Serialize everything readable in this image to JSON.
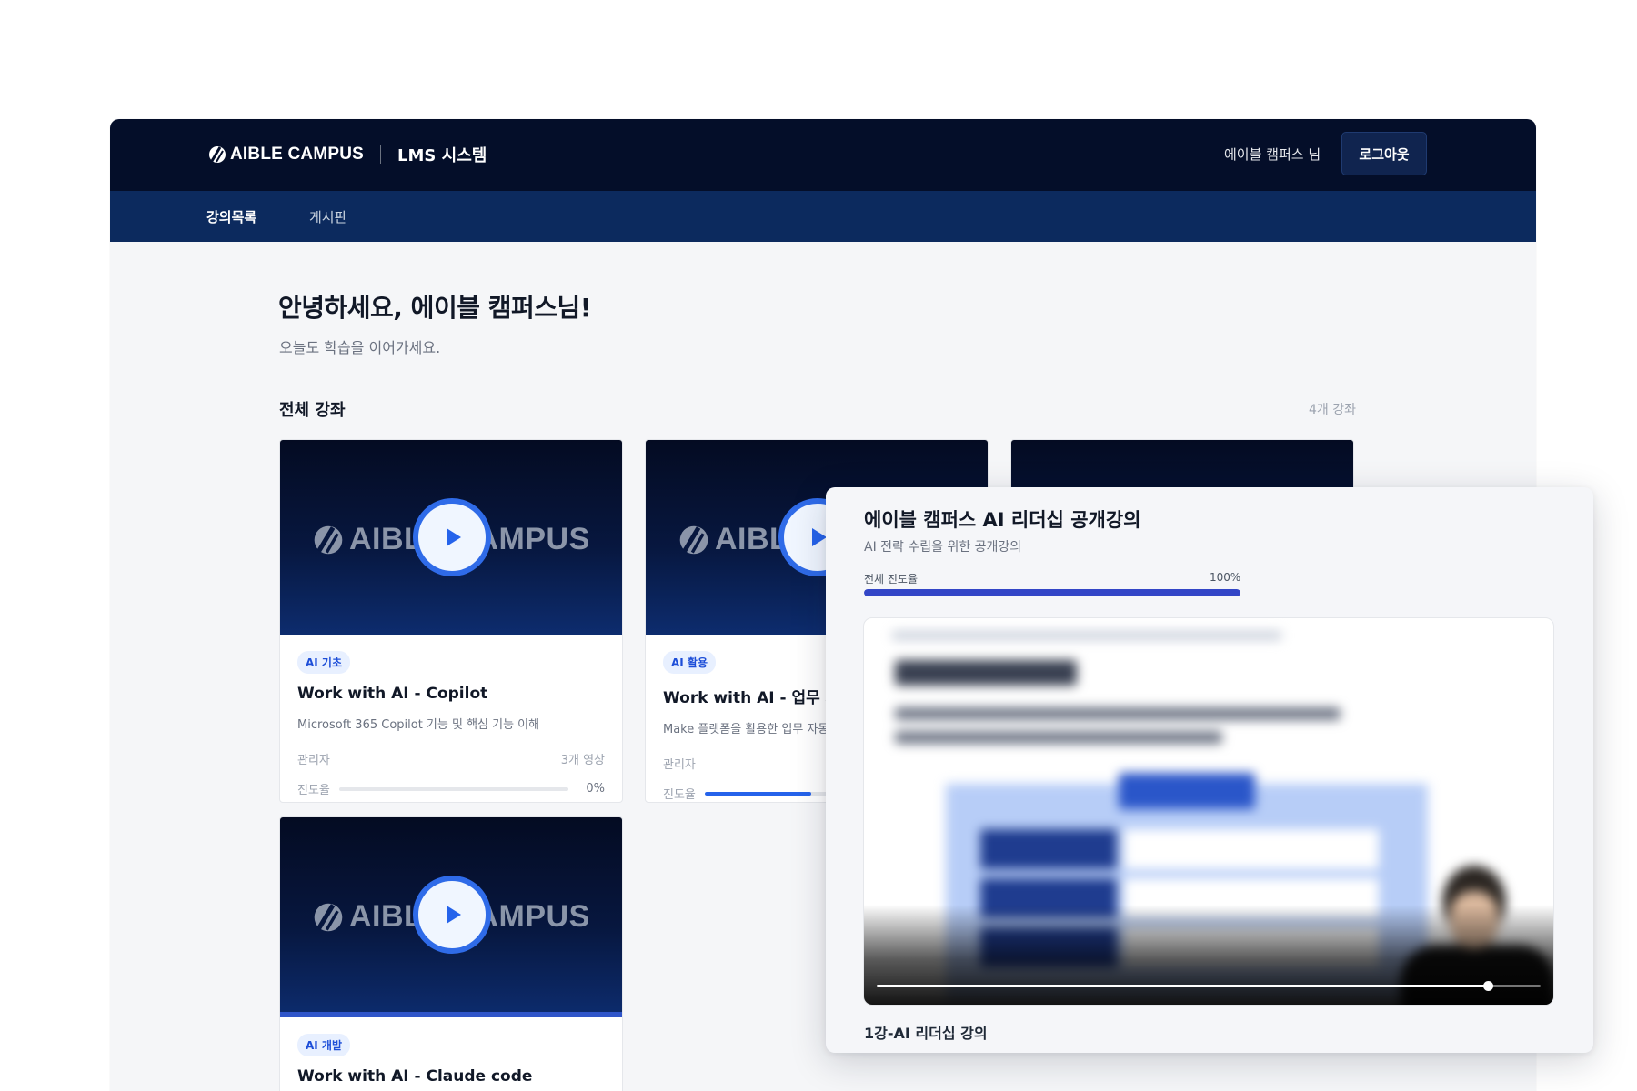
{
  "header": {
    "brand": "AIBLE CAMPUS",
    "system": "LMS 시스템",
    "user": "에이블 캠퍼스 님",
    "logout_label": "로그아웃"
  },
  "nav": {
    "items": [
      {
        "label": "강의목록",
        "active": true
      },
      {
        "label": "게시판",
        "active": false
      }
    ]
  },
  "main": {
    "greeting": "안녕하세요, 에이블 캠퍼스님!",
    "subgreeting": "오늘도 학습을 이어가세요.",
    "section_title": "전체 강좌",
    "course_count": "4개 강좌"
  },
  "courses": [
    {
      "thumb_brand": "AIBLE CAMPUS",
      "tag": "AI 기초",
      "title": "Work with AI - Copilot",
      "desc": "Microsoft 365 Copilot 기능 및 핵심 기능 이해",
      "author": "관리자",
      "videos": "3개 영상",
      "progress_label": "진도율",
      "progress": 0,
      "progress_text": "0%"
    },
    {
      "thumb_brand": "AIBLE CAMPUS",
      "tag": "AI 활용",
      "title": "Work with AI - 업무 자동화",
      "desc": "Make 플랫폼을 활용한 업무 자동화",
      "author": "관리자",
      "progress_label": "진도율",
      "progress": 0.4
    },
    {
      "tag": "AI 개발",
      "title": "Work with AI - Claude code",
      "thumb_brand": "AIBLE CAMPUS"
    }
  ],
  "player": {
    "title": "에이블 캠퍼스 AI 리더십 공개강의",
    "subtitle": "AI 전략 수립을 위한 공개강의",
    "progress_label": "전체 진도율",
    "progress_text": "100%",
    "progress": 1.0,
    "playback_position": 0.92,
    "lesson": "1강-AI 리더십 강의"
  },
  "colors": {
    "header_bg": "#040e29",
    "nav_bg": "#0c2a5e",
    "accent": "#2563eb",
    "player_progress": "#3346c7"
  }
}
